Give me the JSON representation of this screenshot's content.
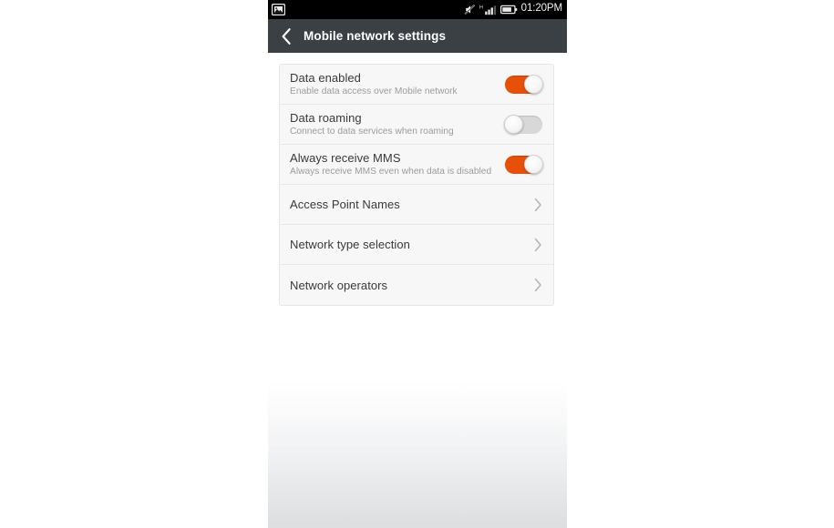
{
  "statusbar": {
    "notification_icon": "photo-icon",
    "silent_icon": "silent-mode-icon",
    "signal_icon": "signal-bars-icon",
    "network_type": "H",
    "battery_icon": "battery-icon",
    "time": "01:20PM",
    "background": "#000000"
  },
  "actionbar": {
    "back_icon": "chevron-left-icon",
    "title": "Mobile network settings",
    "background": "#3b4045",
    "title_color": "#ffffff"
  },
  "colors": {
    "accent_on": "#e8500a",
    "track_off": "#d8d8d8",
    "card_bg": "#f7f7f7",
    "primary_text": "#393939",
    "secondary_text": "#9b9b9b",
    "divider": "#e8e8e8"
  },
  "settings": {
    "rows": [
      {
        "title": "Data enabled",
        "subtitle": "Enable data access over Mobile network",
        "control": "switch",
        "state": "on"
      },
      {
        "title": "Data roaming",
        "subtitle": "Connect to data services when roaming",
        "control": "switch",
        "state": "off"
      },
      {
        "title": "Always receive MMS",
        "subtitle": "Always receive MMS even when data is disabled",
        "control": "switch",
        "state": "on"
      },
      {
        "title": "Access Point Names",
        "subtitle": "",
        "control": "chevron",
        "state": ""
      },
      {
        "title": "Network type selection",
        "subtitle": "",
        "control": "chevron",
        "state": ""
      },
      {
        "title": "Network operators",
        "subtitle": "",
        "control": "chevron",
        "state": ""
      }
    ]
  }
}
